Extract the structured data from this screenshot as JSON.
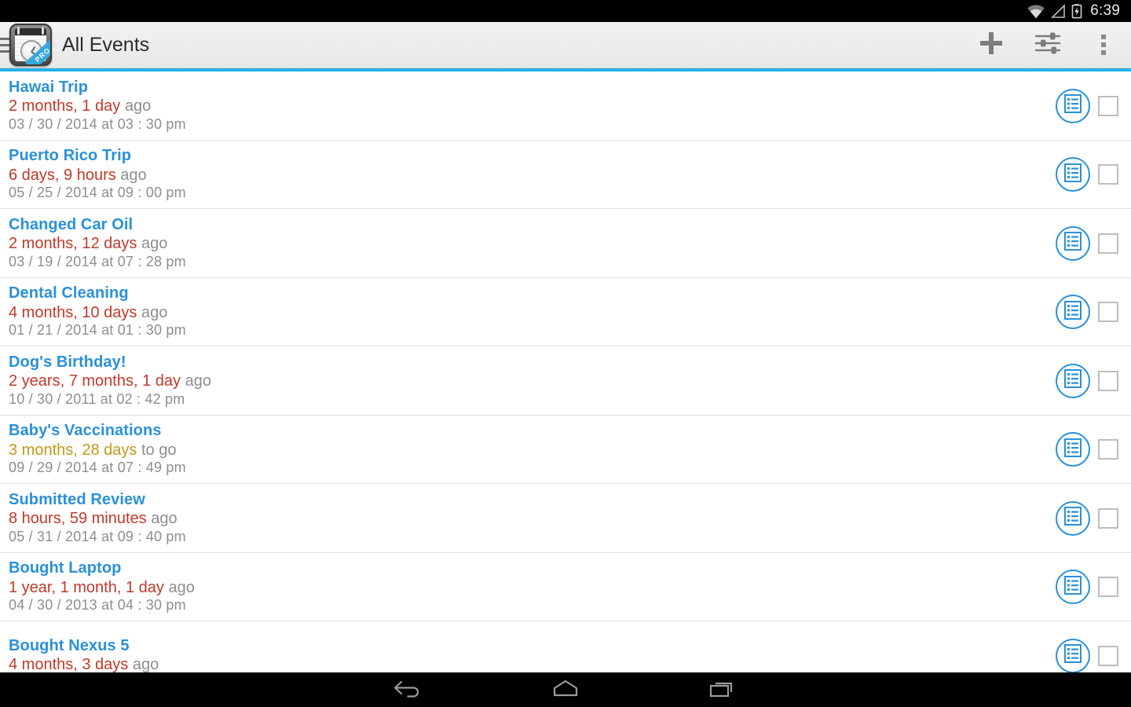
{
  "statusbar": {
    "time": "6:39",
    "icons": [
      "wifi-icon",
      "signal-icon",
      "battery-charging-icon"
    ]
  },
  "actionbar": {
    "title": "All Events",
    "app_icon_badge": "PRO",
    "drawer_label": "drawer-indicator",
    "actions": [
      {
        "name": "add-event-button",
        "label": "Add"
      },
      {
        "name": "filter-settings-button",
        "label": "Settings"
      },
      {
        "name": "overflow-menu-button",
        "label": "More options"
      }
    ],
    "accent_color": "#24b2e8"
  },
  "colors": {
    "title": "#2a90d9",
    "past": "#c0392b",
    "future": "#bf9a1c",
    "muted": "#8e8e8e",
    "divider": "#e2e2e2"
  },
  "events": [
    {
      "title": "Hawai Trip",
      "amount": "2 months, 1 day",
      "suffix": " ago",
      "tense": "past",
      "date": "03 / 30 / 2014 at 03 : 30 pm",
      "checked": false
    },
    {
      "title": "Puerto Rico Trip",
      "amount": "6 days, 9 hours",
      "suffix": " ago",
      "tense": "past",
      "date": "05 / 25 / 2014 at 09 : 00 pm",
      "checked": false
    },
    {
      "title": "Changed Car Oil",
      "amount": "2 months, 12 days",
      "suffix": " ago",
      "tense": "past",
      "date": "03 / 19 / 2014 at 07 : 28 pm",
      "checked": false
    },
    {
      "title": "Dental Cleaning",
      "amount": "4 months, 10 days",
      "suffix": " ago",
      "tense": "past",
      "date": "01 / 21 / 2014 at 01 : 30 pm",
      "checked": false
    },
    {
      "title": "Dog's Birthday!",
      "amount": "2 years, 7 months, 1 day",
      "suffix": " ago",
      "tense": "past",
      "date": "10 / 30 / 2011 at 02 : 42 pm",
      "checked": false
    },
    {
      "title": "Baby's Vaccinations",
      "amount": "3 months, 28 days",
      "suffix": " to go",
      "tense": "future",
      "date": "09 / 29 / 2014 at 07 : 49 pm",
      "checked": false
    },
    {
      "title": "Submitted Review",
      "amount": "8 hours, 59 minutes",
      "suffix": " ago",
      "tense": "past",
      "date": "05 / 31 / 2014 at 09 : 40 pm",
      "checked": false
    },
    {
      "title": "Bought Laptop",
      "amount": "1 year, 1 month, 1 day",
      "suffix": " ago",
      "tense": "past",
      "date": "04 / 30 / 2013 at 04 : 30 pm",
      "checked": false
    },
    {
      "title": "Bought Nexus 5",
      "amount": "4 months, 3 days",
      "suffix": " ago",
      "tense": "past",
      "date": "",
      "checked": false
    }
  ],
  "navbar": {
    "buttons": [
      {
        "name": "nav-back-button",
        "label": "Back"
      },
      {
        "name": "nav-home-button",
        "label": "Home"
      },
      {
        "name": "nav-recents-button",
        "label": "Recents"
      }
    ]
  }
}
